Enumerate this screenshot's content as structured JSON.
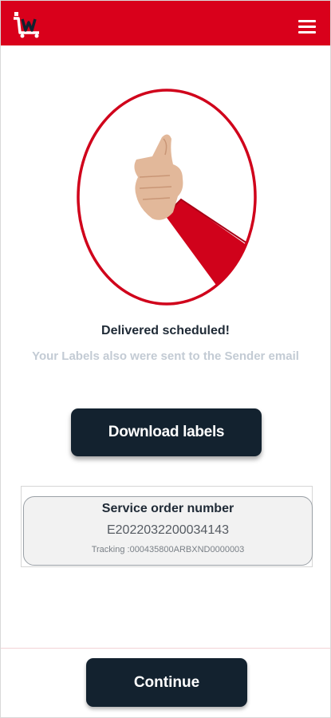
{
  "header": {
    "logo_icon": "iw-cart-logo",
    "menu_icon": "hamburger-icon",
    "background_color": "#d9001b"
  },
  "hero": {
    "illustration": "thumbs-up-icon",
    "ring_color": "#d0021b"
  },
  "status": {
    "title": "Delivered scheduled!",
    "subtitle": "Your Labels also were sent to the Sender email"
  },
  "actions": {
    "download_label": "Download labels",
    "continue_label": "Continue",
    "button_color": "#13222f"
  },
  "order": {
    "label": "Service order number",
    "number": "E2022032200034143",
    "tracking": "Tracking :000435800ARBXND0000003"
  }
}
